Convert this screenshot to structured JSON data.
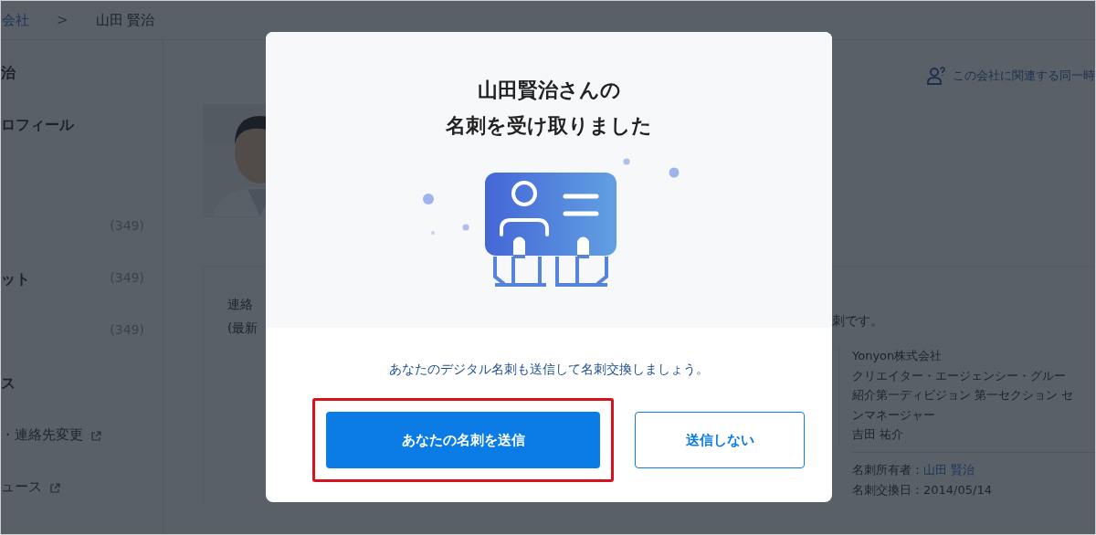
{
  "breadcrumb": {
    "items": [
      {
        "text": "会社",
        "link": true
      },
      {
        "text": "山田 賢治",
        "link": false
      }
    ],
    "separator": ">"
  },
  "sidebar": {
    "items": [
      {
        "kind": "heading",
        "label": "治"
      },
      {
        "kind": "heading",
        "label": "ロフィール"
      },
      {
        "kind": "count",
        "count": "(349)"
      },
      {
        "kind": "heading",
        "label": "ット",
        "count": "(349)"
      },
      {
        "kind": "count",
        "count": "(349)"
      },
      {
        "kind": "heading",
        "label": "ス"
      },
      {
        "kind": "link",
        "label": "・連絡先変更"
      },
      {
        "kind": "link",
        "label": "ュース"
      }
    ]
  },
  "related_link": "この会社に関連する同一時",
  "contact_card": {
    "left_lines": [
      "連絡",
      "(最新"
    ],
    "note": "刺です。",
    "card_lines": [
      "Yonyon株式会社",
      "クリエイター・エージェンシー・グルー",
      "紹介第一ディビジョン 第一セクション セ",
      "ンマネージャー",
      "吉田 祐介"
    ],
    "meta": [
      {
        "label": "名刺所有者：",
        "value": "山田 賢治",
        "link": true
      },
      {
        "label": "名刺交換日：",
        "value": "2014/05/14",
        "link": false
      }
    ]
  },
  "modal": {
    "title_lines": [
      "山田賢治さんの",
      "名刺を受け取りました"
    ],
    "message": "あなたのデジタル名刺も送信して名刺交換しましょう。",
    "buttons": [
      {
        "label": "あなたの名刺を送信",
        "kind": "primary",
        "highlighted": true
      },
      {
        "label": "送信しない",
        "kind": "secondary",
        "highlighted": false
      }
    ]
  }
}
